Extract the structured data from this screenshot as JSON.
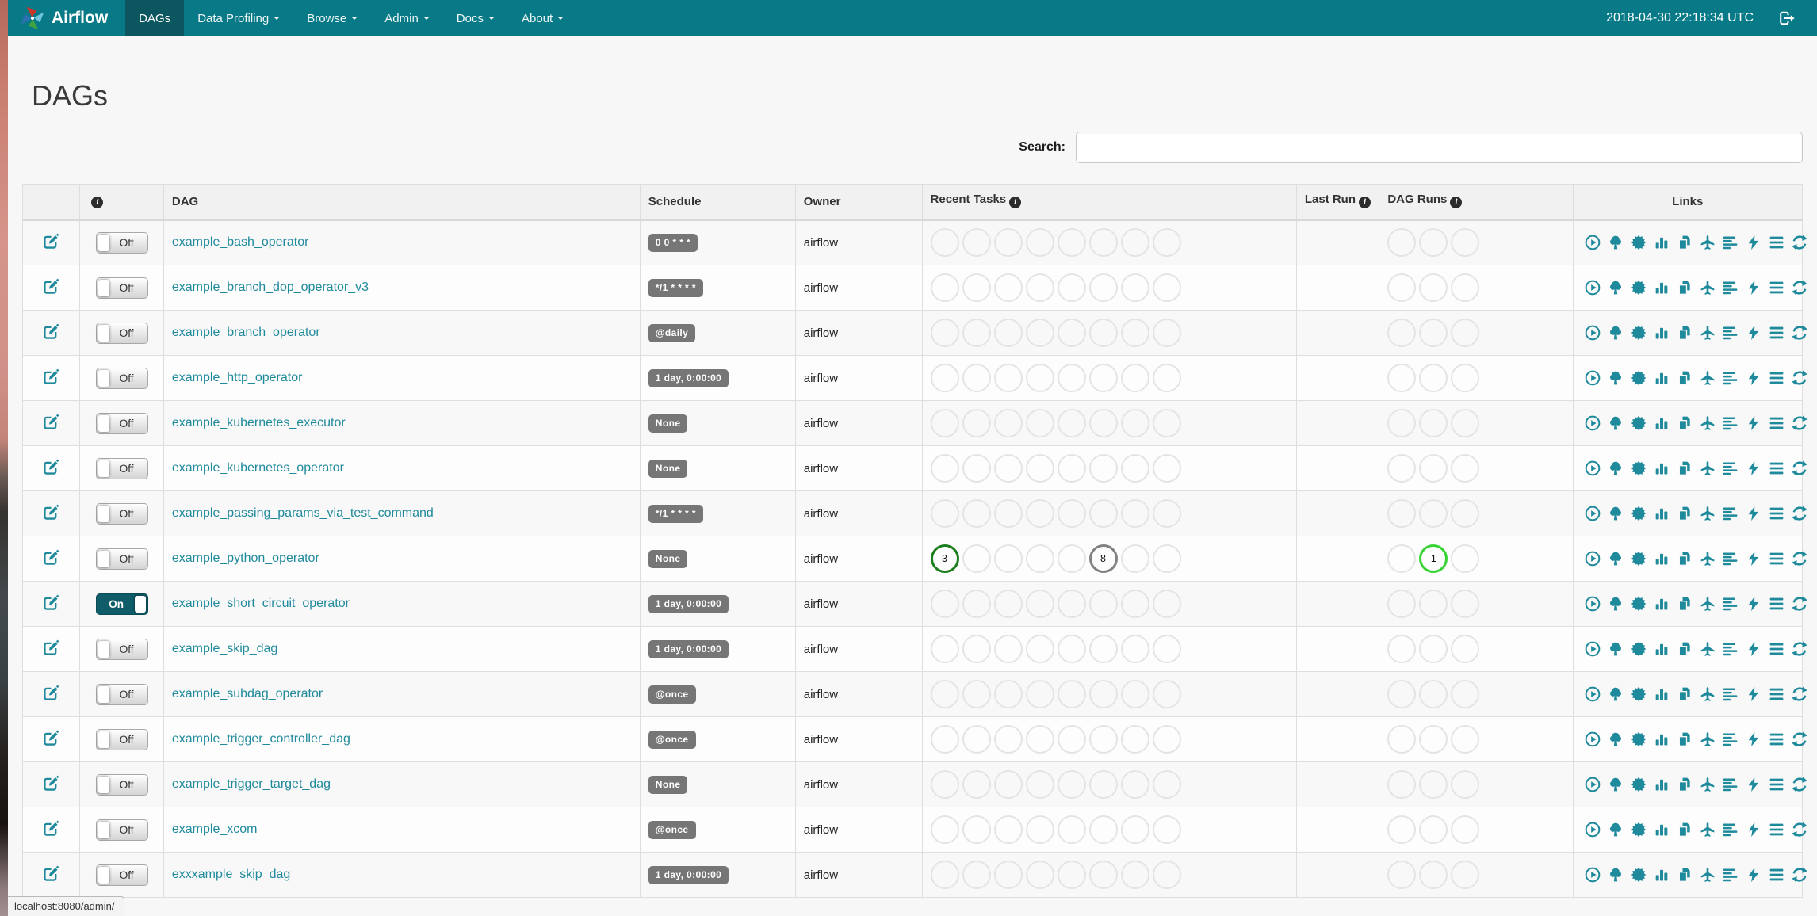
{
  "colors": {
    "navbar": "#087a87",
    "navbar_active": "#0b565f",
    "accent_teal": "#1f8a9c",
    "badge_gray": "#767676",
    "ring_default": "#e4e4e4",
    "ring_success": "#1c7e1c",
    "ring_queued": "#818181",
    "ring_running": "#35d435"
  },
  "navbar": {
    "brand": "Airflow",
    "items": [
      {
        "label": "DAGs",
        "active": true,
        "caret": false
      },
      {
        "label": "Data Profiling",
        "active": false,
        "caret": true
      },
      {
        "label": "Browse",
        "active": false,
        "caret": true
      },
      {
        "label": "Admin",
        "active": false,
        "caret": true
      },
      {
        "label": "Docs",
        "active": false,
        "caret": true
      },
      {
        "label": "About",
        "active": false,
        "caret": true
      }
    ],
    "clock": "2018-04-30 22:18:34 UTC"
  },
  "page": {
    "title": "DAGs",
    "search_label": "Search:",
    "search_value": "",
    "status_bar": "localhost:8080/admin/"
  },
  "table": {
    "headers": {
      "dag": "DAG",
      "schedule": "Schedule",
      "owner": "Owner",
      "recent_tasks": "Recent Tasks",
      "last_run": "Last Run",
      "dag_runs": "DAG Runs",
      "links": "Links"
    },
    "recent_task_slots": 8,
    "dag_run_slots": 3,
    "links_icons": [
      "trigger-dag",
      "tree-view",
      "graph-view",
      "task-duration",
      "task-tries",
      "landing-times",
      "gantt",
      "code-view",
      "logs",
      "refresh"
    ],
    "toggle_labels": {
      "on": "On",
      "off": "Off"
    },
    "rows": [
      {
        "name": "example_bash_operator",
        "toggle": "Off",
        "schedule": "0 0 * * *",
        "owner": "airflow",
        "last_run": "",
        "recent_tasks": [],
        "dag_runs": []
      },
      {
        "name": "example_branch_dop_operator_v3",
        "toggle": "Off",
        "schedule": "*/1 * * * *",
        "owner": "airflow",
        "last_run": "",
        "recent_tasks": [],
        "dag_runs": []
      },
      {
        "name": "example_branch_operator",
        "toggle": "Off",
        "schedule": "@daily",
        "owner": "airflow",
        "last_run": "",
        "recent_tasks": [],
        "dag_runs": []
      },
      {
        "name": "example_http_operator",
        "toggle": "Off",
        "schedule": "1 day, 0:00:00",
        "owner": "airflow",
        "last_run": "",
        "recent_tasks": [],
        "dag_runs": []
      },
      {
        "name": "example_kubernetes_executor",
        "toggle": "Off",
        "schedule": "None",
        "owner": "airflow",
        "last_run": "",
        "recent_tasks": [],
        "dag_runs": []
      },
      {
        "name": "example_kubernetes_operator",
        "toggle": "Off",
        "schedule": "None",
        "owner": "airflow",
        "last_run": "",
        "recent_tasks": [],
        "dag_runs": []
      },
      {
        "name": "example_passing_params_via_test_command",
        "toggle": "Off",
        "schedule": "*/1 * * * *",
        "owner": "airflow",
        "last_run": "",
        "recent_tasks": [],
        "dag_runs": []
      },
      {
        "name": "example_python_operator",
        "toggle": "Off",
        "schedule": "None",
        "owner": "airflow",
        "last_run": "",
        "recent_tasks": [
          {
            "slot": 1,
            "value": "3",
            "ring": "#1c7e1c"
          },
          {
            "slot": 6,
            "value": "8",
            "ring": "#818181"
          }
        ],
        "dag_runs": [
          {
            "slot": 2,
            "value": "1",
            "ring": "#35d435"
          }
        ]
      },
      {
        "name": "example_short_circuit_operator",
        "toggle": "On",
        "schedule": "1 day, 0:00:00",
        "owner": "airflow",
        "last_run": "",
        "recent_tasks": [],
        "dag_runs": []
      },
      {
        "name": "example_skip_dag",
        "toggle": "Off",
        "schedule": "1 day, 0:00:00",
        "owner": "airflow",
        "last_run": "",
        "recent_tasks": [],
        "dag_runs": []
      },
      {
        "name": "example_subdag_operator",
        "toggle": "Off",
        "schedule": "@once",
        "owner": "airflow",
        "last_run": "",
        "recent_tasks": [],
        "dag_runs": []
      },
      {
        "name": "example_trigger_controller_dag",
        "toggle": "Off",
        "schedule": "@once",
        "owner": "airflow",
        "last_run": "",
        "recent_tasks": [],
        "dag_runs": []
      },
      {
        "name": "example_trigger_target_dag",
        "toggle": "Off",
        "schedule": "None",
        "owner": "airflow",
        "last_run": "",
        "recent_tasks": [],
        "dag_runs": []
      },
      {
        "name": "example_xcom",
        "toggle": "Off",
        "schedule": "@once",
        "owner": "airflow",
        "last_run": "",
        "recent_tasks": [],
        "dag_runs": []
      },
      {
        "name": "exxxample_skip_dag",
        "toggle": "Off",
        "schedule": "1 day, 0:00:00",
        "owner": "airflow",
        "last_run": "",
        "recent_tasks": [],
        "dag_runs": []
      }
    ]
  }
}
